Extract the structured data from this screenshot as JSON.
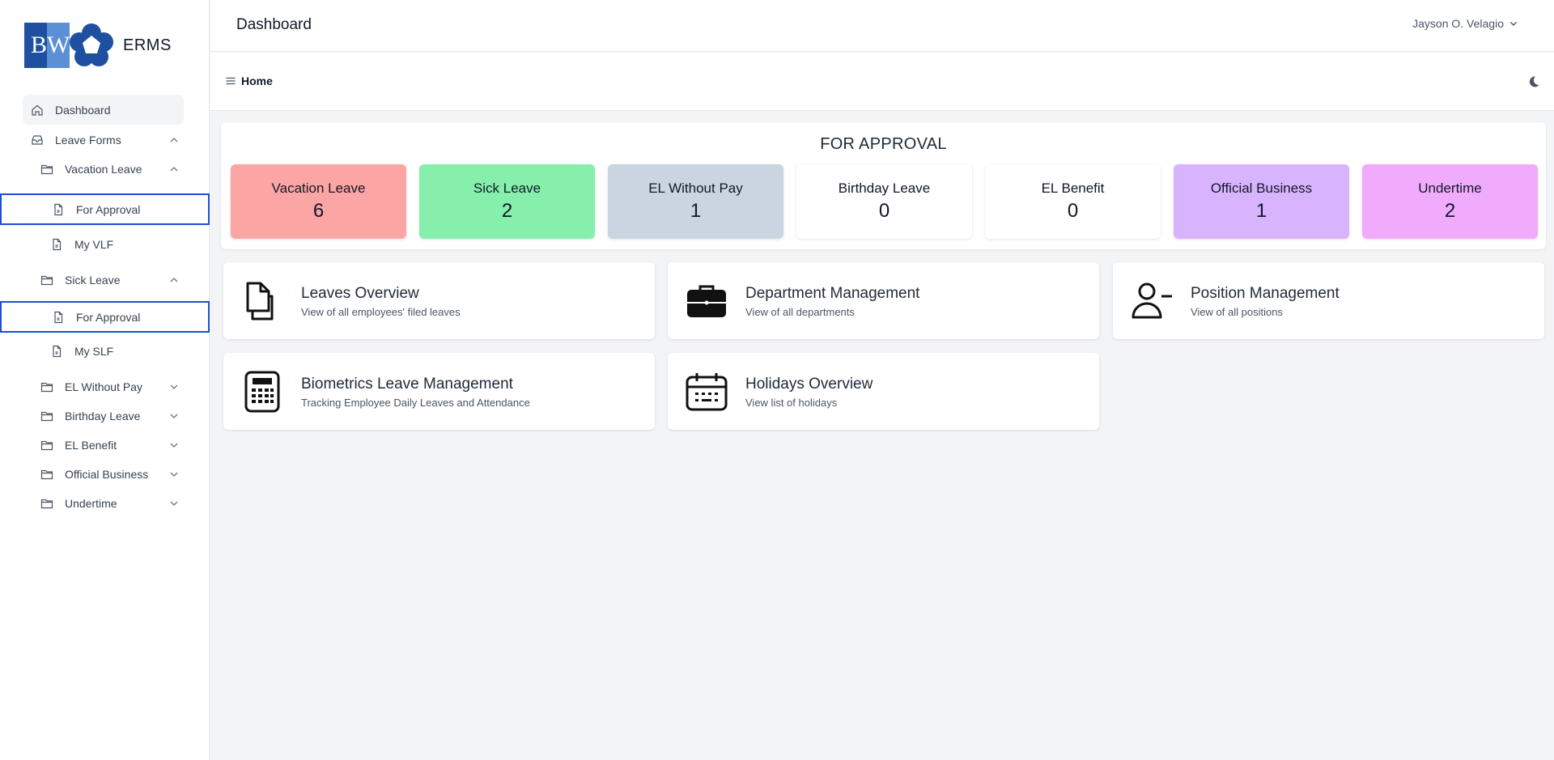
{
  "app": {
    "logo_text": "ERMS",
    "logo_letters": {
      "b": "B",
      "w": "W"
    }
  },
  "header": {
    "title": "Dashboard",
    "user": "Jayson O. Velagio"
  },
  "breadcrumb": {
    "label": "Home"
  },
  "sidebar": {
    "dashboard": "Dashboard",
    "leave_forms": "Leave Forms",
    "vacation_leave": "Vacation Leave",
    "vacation_for_approval": "For Approval",
    "my_vlf": "My VLF",
    "sick_leave": "Sick Leave",
    "sick_for_approval": "For Approval",
    "my_slf": "My SLF",
    "el_without_pay": "EL Without Pay",
    "birthday_leave": "Birthday Leave",
    "el_benefit": "EL Benefit",
    "official_business": "Official Business",
    "undertime": "Undertime"
  },
  "approval": {
    "title": "FOR APPROVAL",
    "stats": [
      {
        "label": "Vacation Leave",
        "count": "6",
        "color": "#fca5a5"
      },
      {
        "label": "Sick Leave",
        "count": "2",
        "color": "#86efac"
      },
      {
        "label": "EL Without Pay",
        "count": "1",
        "color": "#cbd5e1"
      },
      {
        "label": "Birthday Leave",
        "count": "0",
        "color": "#ffffff"
      },
      {
        "label": "EL Benefit",
        "count": "0",
        "color": "#ffffff"
      },
      {
        "label": "Official Business",
        "count": "1",
        "color": "#d8b4fe"
      },
      {
        "label": "Undertime",
        "count": "2",
        "color": "#f0abfc"
      }
    ]
  },
  "cards": [
    {
      "title": "Leaves Overview",
      "subtitle": "View of all employees' filed leaves",
      "icon": "documents-icon"
    },
    {
      "title": "Department Management",
      "subtitle": "View of all departments",
      "icon": "briefcase-icon"
    },
    {
      "title": "Position Management",
      "subtitle": "View of all positions",
      "icon": "user-minus-icon"
    },
    {
      "title": "Biometrics Leave Management",
      "subtitle": "Tracking Employee Daily Leaves and Attendance",
      "icon": "calculator-icon"
    },
    {
      "title": "Holidays Overview",
      "subtitle": "View list of holidays",
      "icon": "calendar-icon"
    }
  ]
}
